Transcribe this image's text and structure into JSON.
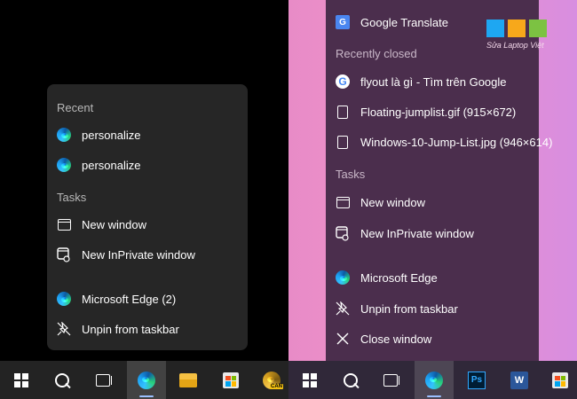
{
  "left_menu": {
    "recent_header": "Recent",
    "recent_items": [
      {
        "label": "personalize",
        "icon": "edge-icon"
      },
      {
        "label": "personalize",
        "icon": "edge-icon"
      }
    ],
    "tasks_header": "Tasks",
    "task_items": [
      {
        "label": "New window",
        "icon": "window-icon"
      },
      {
        "label": "New InPrivate window",
        "icon": "inprivate-icon"
      }
    ],
    "app_items": [
      {
        "label": "Microsoft Edge (2)",
        "icon": "edge-icon"
      },
      {
        "label": "Unpin from taskbar",
        "icon": "unpin-icon"
      }
    ]
  },
  "right_menu": {
    "top_item": {
      "label": "Google Translate",
      "icon": "google-translate-icon"
    },
    "recently_closed_header": "Recently closed",
    "recently_closed_items": [
      {
        "label": "flyout là gì - Tìm trên Google",
        "icon": "google-icon"
      },
      {
        "label": "Floating-jumplist.gif (915×672)",
        "icon": "document-icon"
      },
      {
        "label": "Windows-10-Jump-List.jpg (946×614)",
        "icon": "document-icon"
      }
    ],
    "tasks_header": "Tasks",
    "task_items": [
      {
        "label": "New window",
        "icon": "window-icon"
      },
      {
        "label": "New InPrivate window",
        "icon": "inprivate-icon"
      }
    ],
    "app_items": [
      {
        "label": "Microsoft Edge",
        "icon": "edge-icon"
      },
      {
        "label": "Unpin from taskbar",
        "icon": "unpin-icon"
      },
      {
        "label": "Close window",
        "icon": "close-icon"
      }
    ]
  },
  "left_taskbar": {
    "icons": [
      "windows-start-icon",
      "search-icon",
      "task-view-icon",
      "edge-icon",
      "file-explorer-icon",
      "microsoft-store-icon",
      "edge-canary-icon"
    ],
    "canary_badge": "CAN"
  },
  "right_taskbar": {
    "icons": [
      "windows-start-icon",
      "search-icon",
      "task-view-icon",
      "edge-icon",
      "photoshop-icon",
      "word-icon",
      "microsoft-store-icon"
    ],
    "photoshop_label": "Ps",
    "word_label": "W"
  },
  "watermark": {
    "text": "Sửa Laptop Việt",
    "colors": [
      "#1ea7f2",
      "#f7a81b",
      "#7cc242"
    ]
  },
  "colors": {
    "left_background": "#000000",
    "left_menu": "#262626",
    "right_menu": "#4b2e4d",
    "right_wallpaper": "#e88bc7"
  }
}
